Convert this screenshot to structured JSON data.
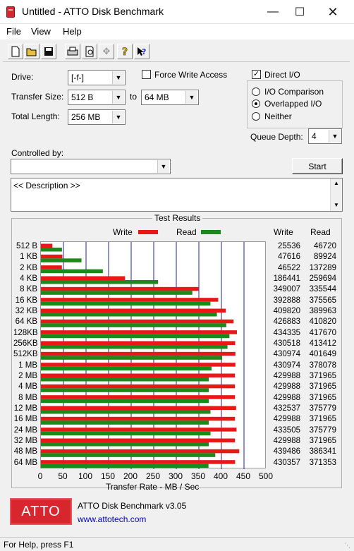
{
  "window": {
    "title": "Untitled - ATTO Disk Benchmark"
  },
  "menu": [
    "File",
    "View",
    "Help"
  ],
  "toolbar_icons": [
    "new-file-icon",
    "open-folder-icon",
    "save-icon",
    "print-icon",
    "print-preview-icon",
    "move-icon",
    "help-icon",
    "context-help-icon"
  ],
  "form": {
    "drive_label": "Drive:",
    "drive_value": "[-f-]",
    "transfer_size_label": "Transfer Size:",
    "transfer_from": "512 B",
    "to_label": "to",
    "transfer_to": "64 MB",
    "total_length_label": "Total Length:",
    "total_length": "256 MB",
    "force_write_label": "Force Write Access",
    "direct_io_label": "Direct I/O",
    "io_comparison_label": "I/O Comparison",
    "overlapped_io_label": "Overlapped I/O",
    "neither_label": "Neither",
    "queue_depth_label": "Queue Depth:",
    "queue_depth": "4",
    "controlled_by_label": "Controlled by:",
    "controlled_by_value": "",
    "start_label": "Start",
    "description": "<< Description >>"
  },
  "colors": {
    "write": "#e81818",
    "read": "#1a8a1a",
    "grid": "#2020a0",
    "atto_red": "#d8262e",
    "link": "#0000c8"
  },
  "results": {
    "title": "Test Results",
    "legend_write": "Write",
    "legend_read": "Read",
    "col_write": "Write",
    "col_read": "Read",
    "xlabel": "Transfer Rate - MB / Sec"
  },
  "chart_data": {
    "type": "bar",
    "orientation": "horizontal",
    "categories": [
      "512 B",
      "1 KB",
      "2 KB",
      "4 KB",
      "8 KB",
      "16 KB",
      "32 KB",
      "64 KB",
      "128KB",
      "256KB",
      "512KB",
      "1 MB",
      "2 MB",
      "4 MB",
      "8 MB",
      "12 MB",
      "16 MB",
      "24 MB",
      "32 MB",
      "48 MB",
      "64 MB"
    ],
    "series": [
      {
        "name": "Write",
        "values": [
          25536,
          47616,
          46522,
          186441,
          349007,
          392888,
          409820,
          426883,
          434335,
          430518,
          430974,
          430974,
          429988,
          429988,
          429988,
          432537,
          429988,
          433505,
          429988,
          439486,
          430357
        ]
      },
      {
        "name": "Read",
        "values": [
          46720,
          89924,
          137289,
          259694,
          335544,
          375565,
          389963,
          410820,
          417670,
          413412,
          401649,
          378078,
          371965,
          371965,
          371965,
          375779,
          371965,
          375779,
          371965,
          386341,
          371353
        ]
      }
    ],
    "xlabel": "Transfer Rate - MB / Sec",
    "xlim": [
      0,
      500
    ],
    "xticks": [
      "0",
      "50",
      "100",
      "150",
      "200",
      "250",
      "300",
      "350",
      "400",
      "450",
      "500"
    ],
    "grid": true
  },
  "footer": {
    "logo_text": "ATTO",
    "product": "ATTO Disk Benchmark v3.05",
    "url": "www.attotech.com"
  },
  "status": "For Help, press F1"
}
